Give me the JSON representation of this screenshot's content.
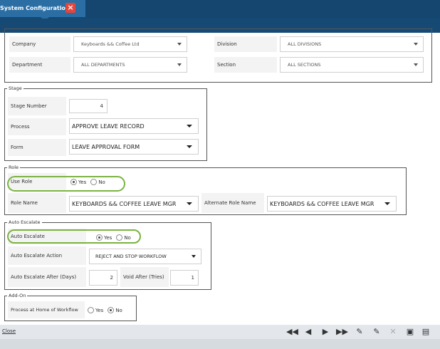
{
  "tab": {
    "title": "System Configurations",
    "close_icon": "close-icon"
  },
  "top": {
    "company_label": "Company",
    "company_value": "Keyboards && Coffee Ltd",
    "division_label": "Division",
    "division_value": "ALL DIVISIONS",
    "department_label": "Department",
    "department_value": "ALL DEPARTMENTS",
    "section_label": "Section",
    "section_value": "ALL SECTIONS"
  },
  "stage": {
    "legend": "Stage",
    "number_label": "Stage Number",
    "number_value": "4",
    "process_label": "Process",
    "process_value": "APPROVE LEAVE RECORD",
    "form_label": "Form",
    "form_value": "LEAVE APPROVAL FORM"
  },
  "role": {
    "legend": "Role",
    "use_role_label": "Use Role",
    "yes": "Yes",
    "no": "No",
    "use_role_selected": "Yes",
    "role_name_label": "Role Name",
    "role_name_value": "KEYBOARDS && COFFEE LEAVE MGR",
    "alt_role_label": "Alternate Role Name",
    "alt_role_value": "KEYBOARDS && COFFEE LEAVE MGR"
  },
  "auto_escalate": {
    "legend": "Auto Escalate",
    "label": "Auto Escalate",
    "yes": "Yes",
    "no": "No",
    "selected": "Yes",
    "action_label": "Auto Escalate Action",
    "action_value": "REJECT AND STOP WORKFLOW",
    "after_days_label": "Auto Escalate After (Days)",
    "after_days_value": "2",
    "void_label": "Void After (Tries)",
    "void_value": "1"
  },
  "addon": {
    "legend": "Add-On",
    "process_home_label": "Process at Home of Workflow",
    "yes": "Yes",
    "no": "No",
    "selected": "No"
  },
  "footer": {
    "close_label": "Close",
    "buttons": [
      "first-icon",
      "prev-icon",
      "next-icon",
      "last-icon",
      "clear-edit-icon",
      "cancel-edit-icon",
      "delete-icon",
      "save-icon",
      "save-edit-icon"
    ]
  },
  "colors": {
    "header": "#15466f",
    "tab": "#2a6ea4",
    "close": "#e2463c",
    "highlight": "#7cb342"
  }
}
